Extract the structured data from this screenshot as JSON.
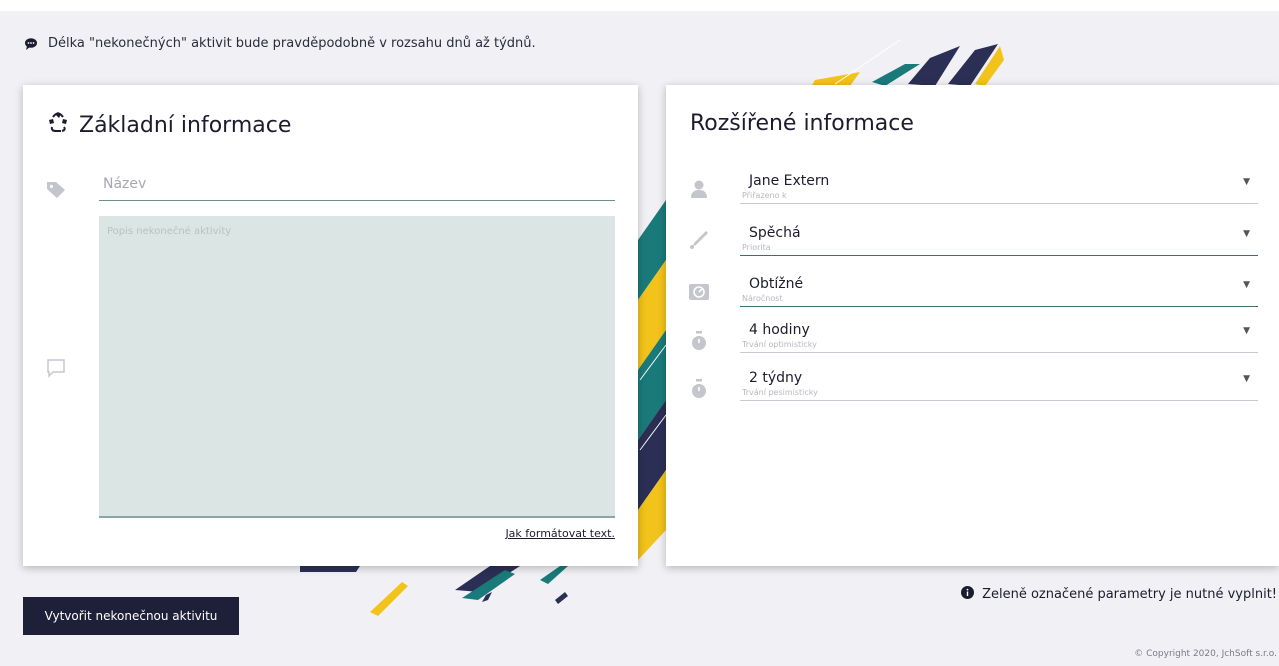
{
  "notice": {
    "icon": "comment-icon",
    "text": "Délka \"nekonečných\" aktivit bude pravděpodobně v rozsahu dnů až týdnů."
  },
  "basic": {
    "icon": "recycle-icon",
    "title": "Základní informace",
    "name_placeholder": "Název",
    "name_value": "",
    "description_placeholder": "Popis nekonečné aktivity",
    "description_value": "",
    "format_link": "Jak formátovat text."
  },
  "extended": {
    "title": "Rozšířené informace",
    "fields": [
      {
        "icon": "user-icon",
        "value": "Jane Extern",
        "label": "Přiřazeno k",
        "required": false
      },
      {
        "icon": "thermometer-icon",
        "value": "Spěchá",
        "label": "Priorita",
        "required": true
      },
      {
        "icon": "gauge-icon",
        "value": "Obtížné",
        "label": "Náročnost",
        "required": true
      },
      {
        "icon": "stopwatch-icon",
        "value": "4 hodiny",
        "label": "Trvání optimisticky",
        "required": false
      },
      {
        "icon": "stopwatch-icon",
        "value": "2 týdny",
        "label": "Trvání pesimisticky",
        "required": false
      }
    ]
  },
  "actions": {
    "submit_label": "Vytvořit nekonečnou aktivitu"
  },
  "required_note": {
    "icon": "info-icon",
    "text": "Zeleně označené parametry je nutné vyplnit!"
  },
  "footer": {
    "copyright": "© Copyright 2020, JchSoft s.r.o."
  },
  "colors": {
    "primary": "#1e1f38",
    "accent_teal": "#1a7a7a",
    "accent_yellow": "#f2c31a",
    "accent_navy": "#2c2f55",
    "required_line": "#3e6e6a"
  }
}
